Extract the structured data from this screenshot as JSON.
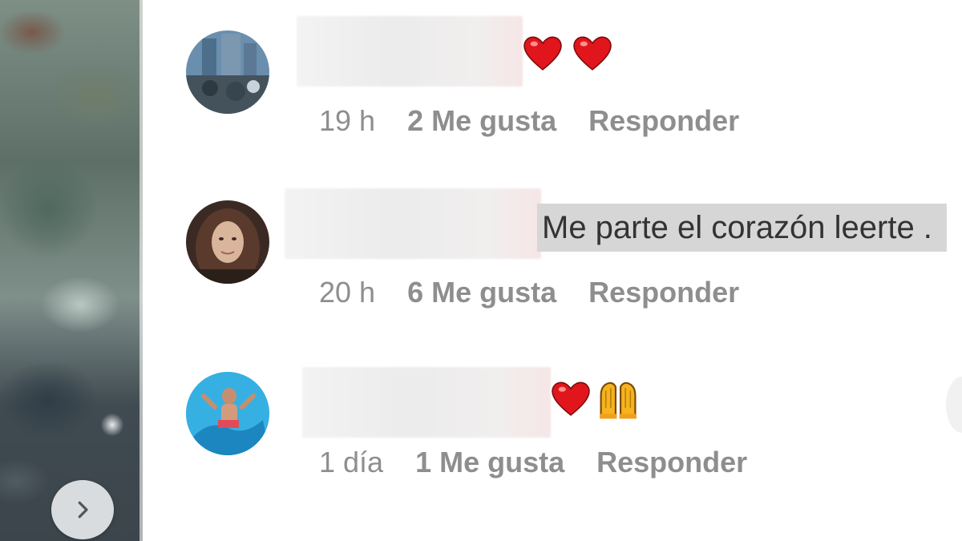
{
  "comments": [
    {
      "time": "19 h",
      "likes": "2 Me gusta",
      "reply": "Responder",
      "text": "",
      "emojis": [
        "heart-icon",
        "heart-icon"
      ]
    },
    {
      "time": "20 h",
      "likes": "6 Me gusta",
      "reply": "Responder",
      "text": "Me parte el corazón leerte .",
      "emojis": []
    },
    {
      "time": "1 día",
      "likes": "1 Me gusta",
      "reply": "Responder",
      "text": "",
      "emojis": [
        "heart-icon",
        "raising-hands-icon"
      ]
    }
  ],
  "colors": {
    "meta_text": "#8e8e8e",
    "highlight": "#d6d6d6",
    "heart": "#e0161c"
  }
}
